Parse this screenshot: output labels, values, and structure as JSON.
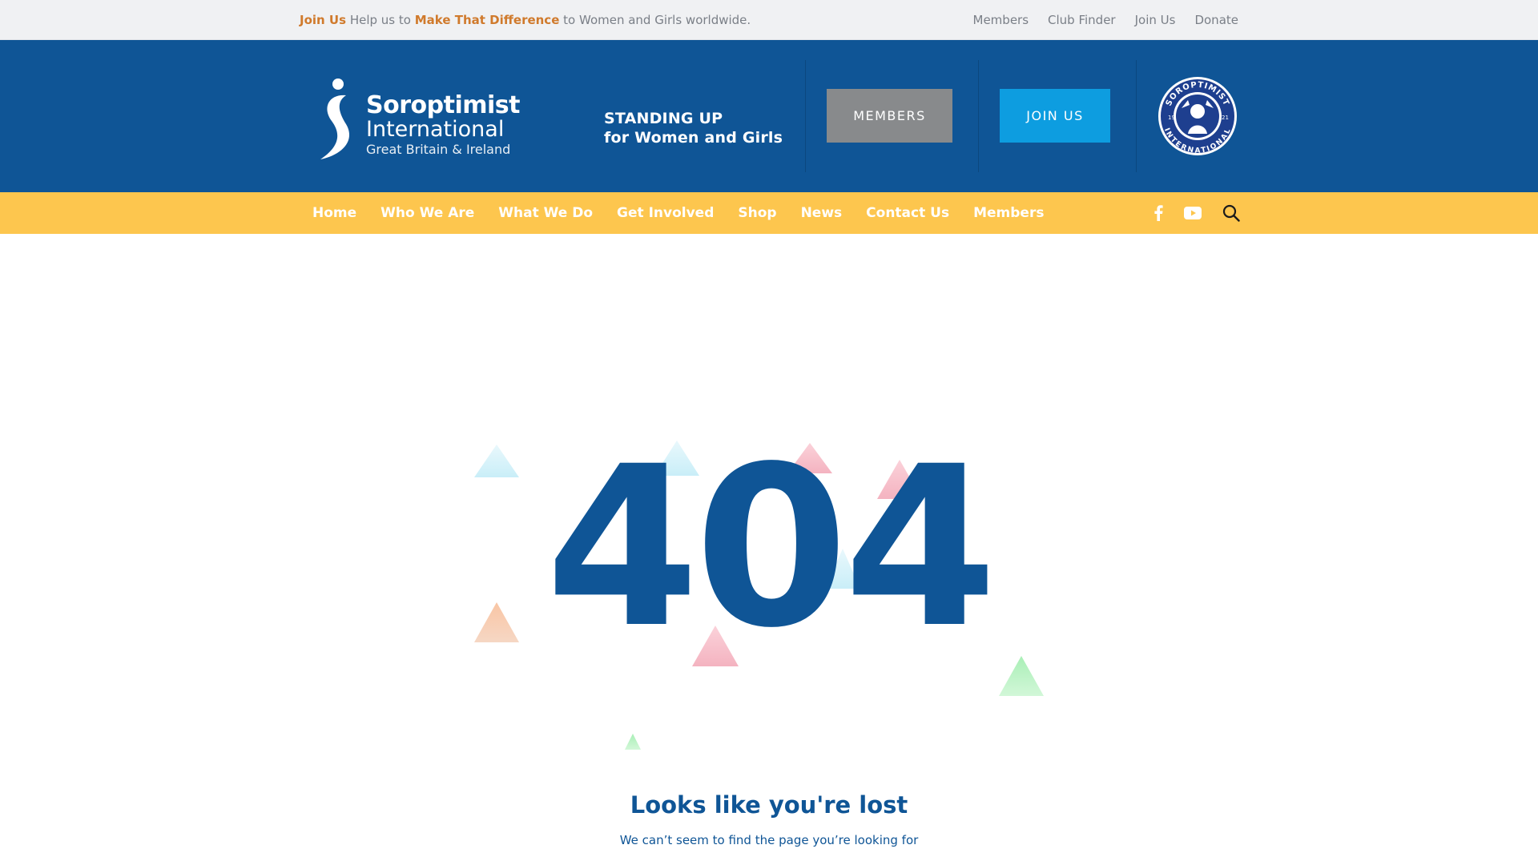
{
  "topbar": {
    "promo": {
      "join": "Join Us",
      "text1": " Help us to ",
      "highlight": "Make That Difference",
      "text2": " to Women and Girls worldwide."
    },
    "links": [
      "Members",
      "Club Finder",
      "Join Us",
      "Donate"
    ]
  },
  "header": {
    "logo": {
      "line1": "Soroptimist",
      "line2": "International",
      "line3": "Great Britain & Ireland"
    },
    "tagline": {
      "line1": "STANDING UP",
      "line2": "for Women and Girls"
    },
    "members_button": "MEMBERS",
    "join_button": "JOIN US",
    "seal": {
      "top": "SOROPTIMIST",
      "bottom": "INTERNATIONAL",
      "year_left": "19",
      "year_right": "21"
    }
  },
  "nav": {
    "items": [
      "Home",
      "Who We Are",
      "What We Do",
      "Get Involved",
      "Shop",
      "News",
      "Contact Us",
      "Members"
    ],
    "icons": [
      "facebook-icon",
      "youtube-icon",
      "search-icon"
    ]
  },
  "error": {
    "code": "404",
    "title": "Looks like you're lost",
    "subtitle": "We can’t seem to find the page you’re looking for"
  },
  "colors": {
    "brand_blue": "#0f5596",
    "nav_yellow": "#fdc64e",
    "accent_orange": "#d07a2c",
    "join_blue": "#0d9de0",
    "members_grey": "#888a8c"
  }
}
